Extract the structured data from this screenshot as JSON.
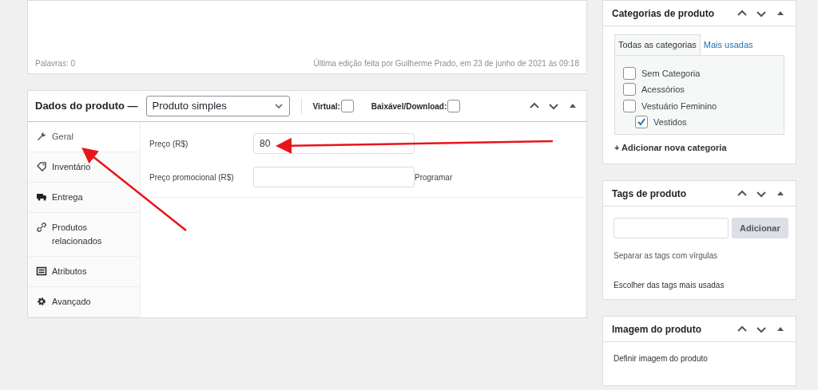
{
  "editor": {
    "word_count": "Palavras: 0",
    "last_edit": "Última edição feita por Guilherme Prado, em 23 de junho de 2021 às 09:18"
  },
  "product_data": {
    "title": "Dados do produto —",
    "type_select": "Produto simples",
    "options": [
      {
        "label": "Virtual:",
        "checked": false
      },
      {
        "label": "Baixável/Download:",
        "checked": false
      }
    ],
    "tabs": [
      {
        "label": "Geral",
        "kind": "wrench",
        "selected": true
      },
      {
        "label": "Inventário",
        "kind": "tag",
        "selected": false
      },
      {
        "label": "Entrega",
        "kind": "truck",
        "selected": false
      },
      {
        "label": "Produtos relacionados",
        "kind": "link",
        "selected": false
      },
      {
        "label": "Atributos",
        "kind": "list",
        "selected": false
      },
      {
        "label": "Avançado",
        "kind": "gear",
        "selected": false
      }
    ],
    "fields": [
      {
        "label": "Preço (R$)",
        "value": "80"
      },
      {
        "label": "Preço promocional (R$)",
        "link": "Programar"
      }
    ]
  },
  "categories": {
    "title": "Categorias de produto",
    "tabs": [
      {
        "label": "Todas as categorias",
        "selected": true
      },
      {
        "label": "Mais usadas",
        "selected": false
      }
    ],
    "items": [
      {
        "label": "Sem Categoria",
        "checked": false
      },
      {
        "label": "Acessórios",
        "checked": false
      },
      {
        "label": "Vestuário Feminino",
        "checked": false,
        "children": [
          {
            "label": "Vestidos",
            "checked": true
          }
        ]
      }
    ],
    "add_link": "+ Adicionar nova categoria"
  },
  "tags": {
    "title": "Tags de produto",
    "button": "Adicionar",
    "hint": "Separar as tags com vírgulas",
    "choose_link": "Escolher das tags mais usadas"
  },
  "image": {
    "title": "Imagem do produto",
    "link": "Definir imagem do produto"
  }
}
